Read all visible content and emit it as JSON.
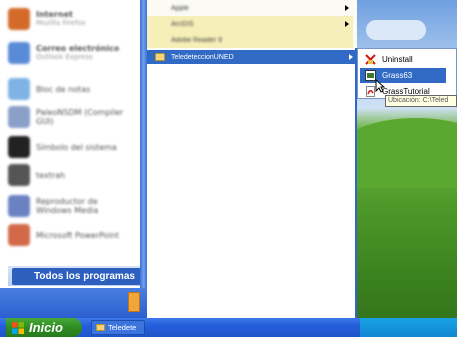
{
  "left_column": {
    "items": [
      {
        "label": "Internet",
        "sub": "Mozilla Firefox",
        "color": "#d36a2a"
      },
      {
        "label": "Correo electrónico",
        "sub": "Outlook Express",
        "color": "#5a8bd6"
      },
      {
        "label": "Bloc de notas",
        "sub": "",
        "color": "#7fb3e6"
      },
      {
        "label": "PaleoNSDM (Compiler GUI)",
        "sub": "",
        "color": "#8aa0c8"
      },
      {
        "label": "Símbolo del sistema",
        "sub": "",
        "color": "#222222"
      },
      {
        "label": "textrah",
        "sub": "",
        "color": "#555555"
      },
      {
        "label": "Reproductor de Windows Media",
        "sub": "",
        "color": "#6b82c2"
      },
      {
        "label": "Microsoft PowerPoint",
        "sub": "",
        "color": "#d26a4a"
      }
    ],
    "all_programs_label": "Todos los programas"
  },
  "programs_menu": {
    "items_top": [
      {
        "label": "Apple",
        "has_submenu": true
      },
      {
        "label": "ArcGIS",
        "has_submenu": true
      },
      {
        "label": "Adobe Reader 9",
        "has_submenu": false
      }
    ],
    "selected_folder": "TeledeteccionUNED"
  },
  "submenu": {
    "items": [
      {
        "label": "Uninstall",
        "icon": "uninstall-icon"
      },
      {
        "label": "Grass63",
        "icon": "grass-app-icon"
      },
      {
        "label": "GrassTutorial",
        "icon": "pdf-icon"
      }
    ],
    "tooltip": "Ubicación: C:\\Teled"
  },
  "taskbar": {
    "start_label": "Inicio",
    "task_label": "Teledete"
  },
  "colors": {
    "selection": "#316ac5",
    "taskbar": "#245edb",
    "start_green": "#2f8c23"
  }
}
